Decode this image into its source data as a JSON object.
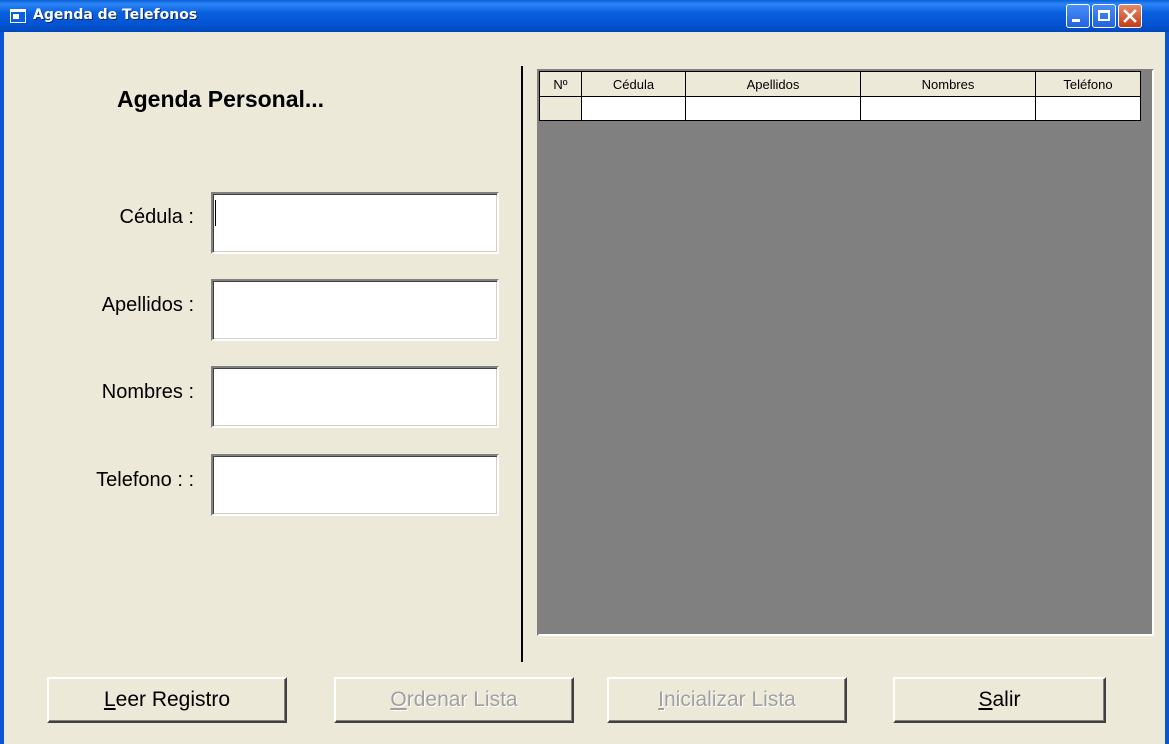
{
  "window": {
    "title": "Agenda de Telefonos",
    "title_bar_color": "#0A60E0",
    "background": "#ECE9D8"
  },
  "form": {
    "heading": "Agenda Personal...",
    "fields": [
      {
        "label": "Cédula :",
        "value": ""
      },
      {
        "label": "Apellidos :",
        "value": ""
      },
      {
        "label": "Nombres :",
        "value": ""
      },
      {
        "label": "Telefono : :",
        "value": ""
      }
    ]
  },
  "grid": {
    "columns": [
      "Nº",
      "Cédula",
      "Apellidos",
      "Nombres",
      "Teléfono"
    ],
    "rows": [
      [
        "",
        "",
        "",
        "",
        ""
      ]
    ],
    "background": "#808080"
  },
  "buttons": {
    "leer": {
      "accel": "L",
      "rest": "eer Registro",
      "enabled": true
    },
    "ordenar": {
      "accel": "O",
      "rest": "rdenar Lista",
      "enabled": false
    },
    "inicializar": {
      "accel": "I",
      "rest": "nicializar Lista",
      "enabled": false
    },
    "salir": {
      "accel": "S",
      "rest": "alir",
      "enabled": true
    }
  }
}
